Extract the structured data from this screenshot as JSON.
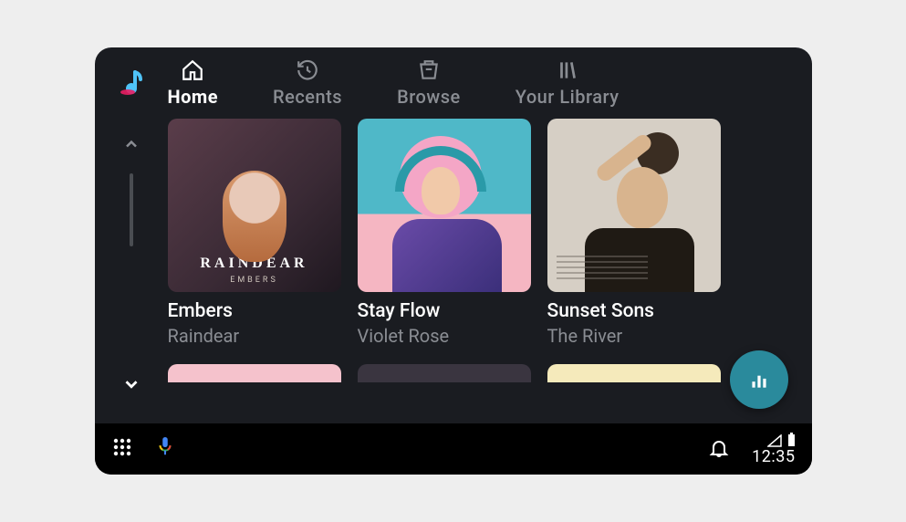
{
  "tabs": [
    {
      "label": "Home",
      "icon": "home-icon"
    },
    {
      "label": "Recents",
      "icon": "recents-icon"
    },
    {
      "label": "Browse",
      "icon": "browse-icon"
    },
    {
      "label": "Your Library",
      "icon": "library-icon"
    }
  ],
  "active_tab": 0,
  "albums": [
    {
      "title": "Embers",
      "artist": "Raindear",
      "art_title": "RAINDEAR",
      "art_subtitle": "EMBERS"
    },
    {
      "title": "Stay Flow",
      "artist": "Violet Rose"
    },
    {
      "title": "Sunset Sons",
      "artist": "The River"
    }
  ],
  "status": {
    "time": "12:35"
  },
  "colors": {
    "fab_bg": "#2a8a9c",
    "background": "#1a1c21",
    "text_muted": "#8a8d93"
  }
}
